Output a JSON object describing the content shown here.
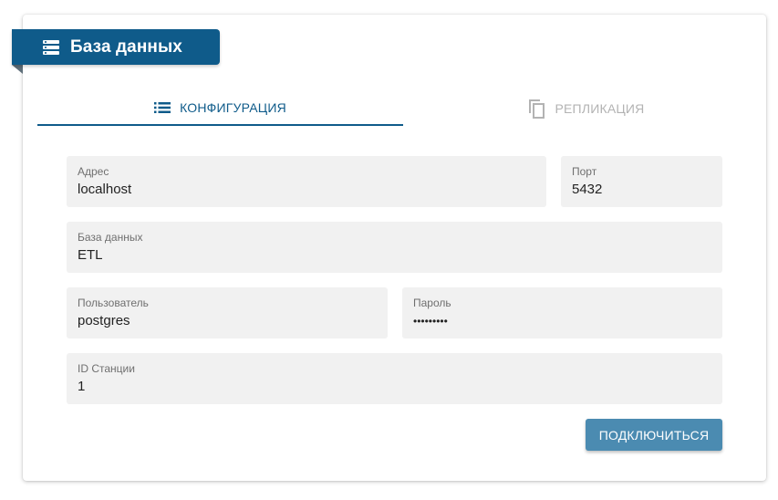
{
  "header": {
    "title": "База данных",
    "icon": "database-icon"
  },
  "tabs": [
    {
      "label": "КОНФИГУРАЦИЯ",
      "icon": "list-icon",
      "active": true
    },
    {
      "label": "РЕПЛИКАЦИЯ",
      "icon": "copy-icon",
      "active": false
    }
  ],
  "form": {
    "address": {
      "label": "Адрес",
      "value": "localhost"
    },
    "port": {
      "label": "Порт",
      "value": "5432"
    },
    "database": {
      "label": "База данных",
      "value": "ETL"
    },
    "user": {
      "label": "Пользователь",
      "value": "postgres"
    },
    "password": {
      "label": "Пароль",
      "value": "•••••••••"
    },
    "station_id": {
      "label": "ID Станции",
      "value": "1"
    }
  },
  "actions": {
    "connect_label": "ПОДКЛЮЧИТЬСЯ"
  },
  "colors": {
    "primary": "#0f5b8a",
    "button": "#4b8bb1",
    "field_bg": "#f1f1f1",
    "inactive": "#b3b3b3"
  }
}
